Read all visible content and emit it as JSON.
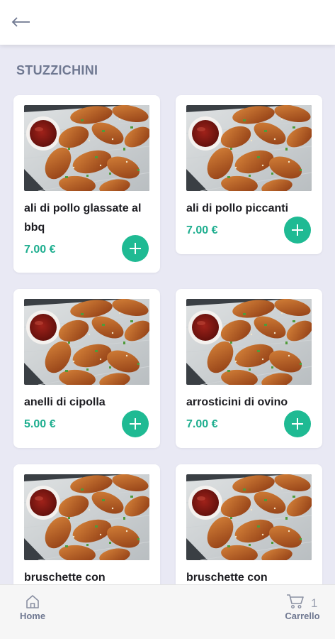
{
  "header": {
    "back_icon": "arrow-left-icon"
  },
  "section": {
    "title": "STUZZICHINI"
  },
  "products": [
    {
      "name": "ali di pollo glassate al bbq",
      "price": "7.00 €"
    },
    {
      "name": "ali di pollo piccanti",
      "price": "7.00 €"
    },
    {
      "name": "anelli di cipolla",
      "price": "5.00 €"
    },
    {
      "name": "arrosticini di ovino",
      "price": "7.00 €"
    },
    {
      "name": "bruschette con",
      "price": ""
    },
    {
      "name": "bruschette con",
      "price": ""
    }
  ],
  "add_icon": "plus-icon",
  "bottom_nav": {
    "home_label": "Home",
    "cart_label": "Carrello",
    "cart_count": "1"
  },
  "colors": {
    "accent": "#1fba93",
    "price": "#1eae8f",
    "background": "#e9e9f4",
    "nav_text": "#6f7891"
  }
}
